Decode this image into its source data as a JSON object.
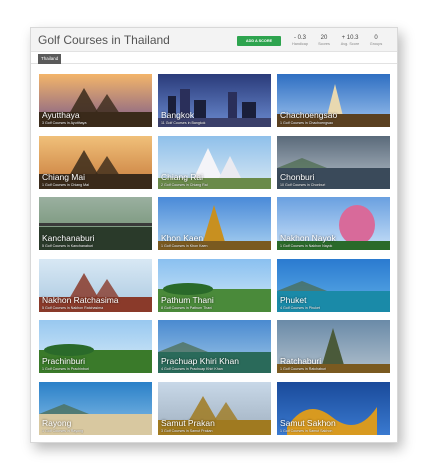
{
  "page": {
    "title": "Golf Courses in Thailand",
    "add_score_label": "ADD A SCORE",
    "stats": [
      {
        "value": "- 0.3",
        "label": "Handicap"
      },
      {
        "value": "20",
        "label": "Scores"
      },
      {
        "value": "+ 10.3",
        "label": "Avg. Score"
      },
      {
        "value": "0",
        "label": "Groups"
      }
    ],
    "tab": "Thailand"
  },
  "regions": [
    {
      "name": "Ayutthaya",
      "sub": "3 Golf Courses in Ayutthaya"
    },
    {
      "name": "Bangkok",
      "sub": "11 Golf Courses in Bangkok"
    },
    {
      "name": "Chachoengsao",
      "sub": "1 Golf Courses in Chachoengsao"
    },
    {
      "name": "Chiang Mai",
      "sub": "1 Golf Courses in Chiang Mai"
    },
    {
      "name": "Chiang Rai",
      "sub": "2 Golf Courses in Chiang Rai"
    },
    {
      "name": "Chonburi",
      "sub": "10 Golf Courses in Chonburi"
    },
    {
      "name": "Kanchanaburi",
      "sub": "5 Golf Courses in Kanchanaburi"
    },
    {
      "name": "Khon Kaen",
      "sub": "1 Golf Courses in Khon Kaen"
    },
    {
      "name": "Nakhon Nayok",
      "sub": "1 Golf Courses in Nakhon Nayok"
    },
    {
      "name": "Nakhon Ratchasima",
      "sub": "5 Golf Courses in Nakhon Ratchasima"
    },
    {
      "name": "Pathum Thani",
      "sub": "8 Golf Courses in Pathum Thani"
    },
    {
      "name": "Phuket",
      "sub": "4 Golf Courses in Phuket"
    },
    {
      "name": "Prachinburi",
      "sub": "1 Golf Courses in Prachinburi"
    },
    {
      "name": "Prachuap Khiri Khan",
      "sub": "4 Golf Courses in Prachuap Khiri Khan"
    },
    {
      "name": "Ratchaburi",
      "sub": "1 Golf Courses in Ratchaburi"
    },
    {
      "name": "Rayong",
      "sub": "1 Golf Courses in Rayong"
    },
    {
      "name": "Samut Prakan",
      "sub": "3 Golf Courses in Samut Prakan"
    },
    {
      "name": "Samut Sakhon",
      "sub": "1 Golf Courses in Samut Sakhon"
    }
  ]
}
